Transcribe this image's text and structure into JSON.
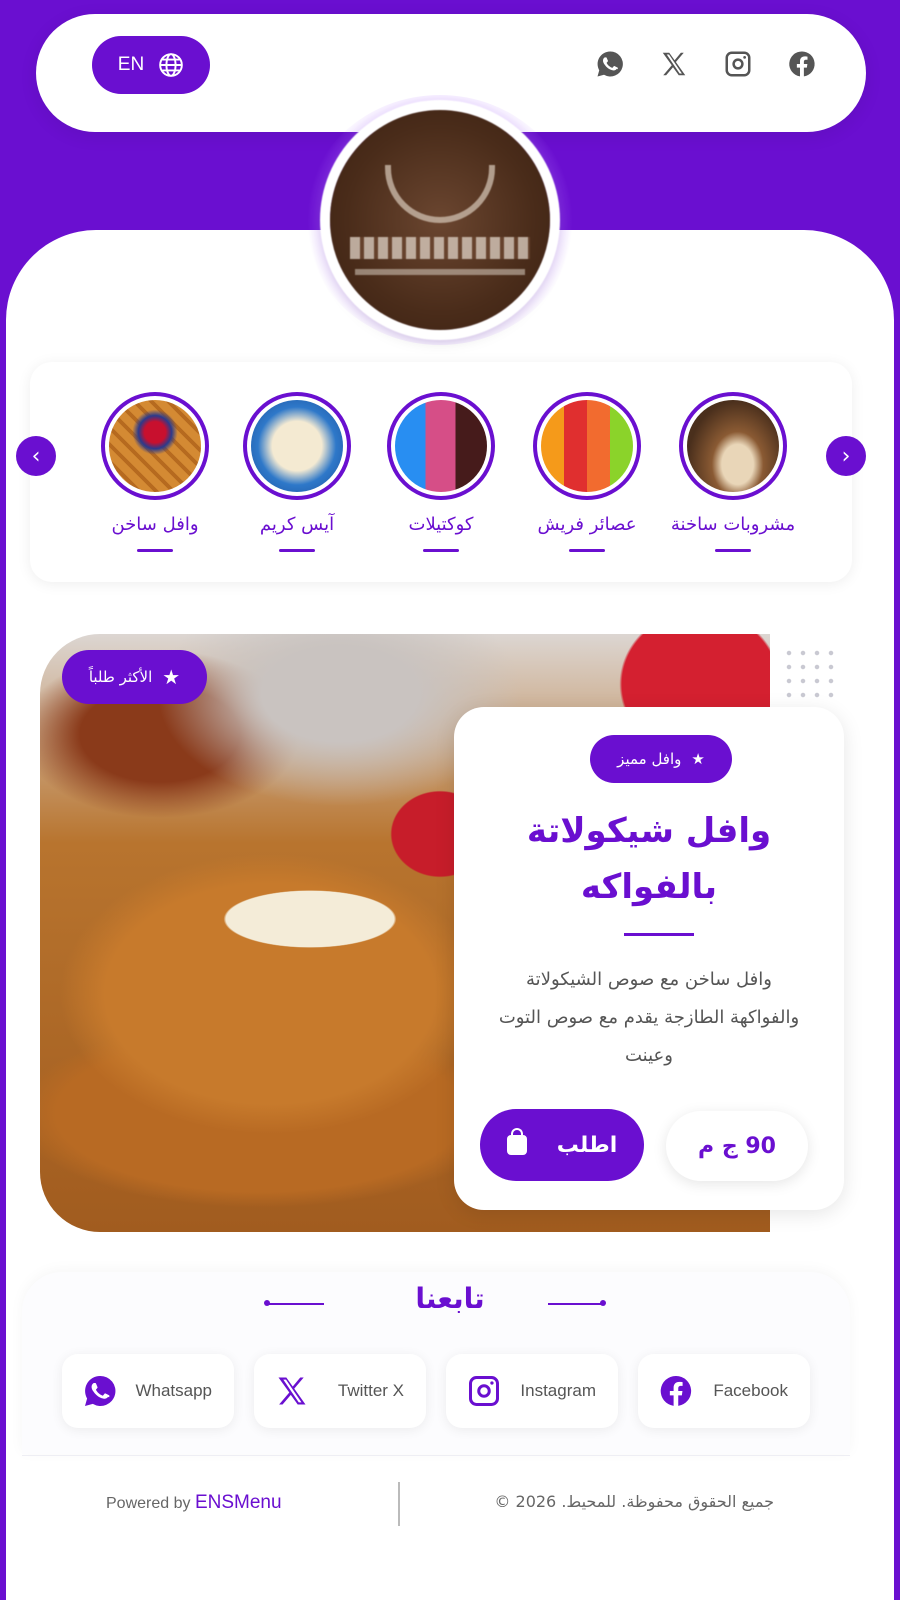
{
  "colors": {
    "accent": "#6a0fd0",
    "text": "#555555",
    "white": "#ffffff"
  },
  "header": {
    "language_label": "EN",
    "language_icon": "globe-icon",
    "social_icons": [
      "whatsapp-icon",
      "x-icon",
      "instagram-icon",
      "facebook-icon"
    ]
  },
  "logo": {
    "icon": "cafe-logo"
  },
  "categories": [
    {
      "label": "وافل ساخن",
      "image": "waffle-photo"
    },
    {
      "label": "آيس كريم",
      "image": "ice-cream-photo"
    },
    {
      "label": "كوكتيلات",
      "image": "cocktails-photo"
    },
    {
      "label": "عصائر فريش",
      "image": "juices-photo"
    },
    {
      "label": "مشروبات ساخنة",
      "image": "hot-drinks-photo"
    }
  ],
  "nav": {
    "prev_icon": "chevron-left-icon",
    "next_icon": "chevron-right-icon"
  },
  "featured": {
    "top_badge": "الأكثر طلباً",
    "tag": "وافل مميز",
    "title": "وافل شيكولاتة بالفواكه",
    "description": "وافل ساخن مع صوص الشيكولاتة والفواكهة الطازجة يقدم مع صوص التوت وعينت",
    "price": "90 ج م",
    "order_label": "اطلب"
  },
  "follow": {
    "title": "تابعنا",
    "links": [
      {
        "label": "Whatsapp",
        "icon": "whatsapp-icon"
      },
      {
        "label": "Twitter X",
        "icon": "x-icon"
      },
      {
        "label": "Instagram",
        "icon": "instagram-icon"
      },
      {
        "label": "Facebook",
        "icon": "facebook-icon"
      }
    ]
  },
  "footer": {
    "powered_by": "Powered by",
    "brand": "ENSMenu",
    "copyright": "جميع الحقوق محفوظة. للمحيط. 2026 ©"
  }
}
